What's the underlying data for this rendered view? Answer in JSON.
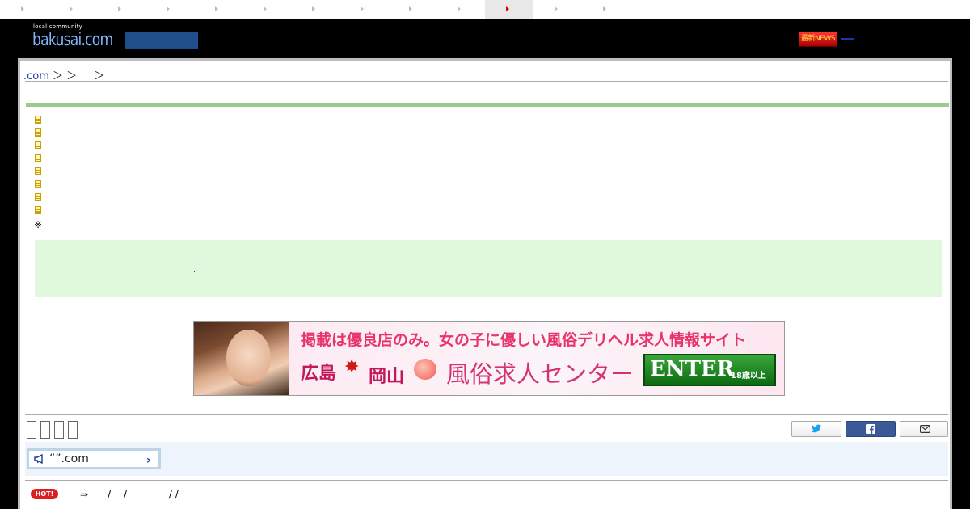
{
  "top_nav": {
    "active_index": 10,
    "item_count": 13
  },
  "header": {
    "logo_tagline": "local community",
    "logo_text": "bakusai.com",
    "news_label": "最新NEWS"
  },
  "breadcrumb": {
    "home": ".com",
    "separators": " ＞ ＞ 　 ＞"
  },
  "doc_list": {
    "count": 8
  },
  "note_mark": "※",
  "banner": {
    "headline": "掲載は優良店のみ。女の子に優しい風俗デリヘル求人情報サイト",
    "region1": "広島",
    "region2": "岡山",
    "site_name": "風俗求人センター",
    "enter_label": "ENTER",
    "age_label": "18歳以上"
  },
  "announce": {
    "text": "“”.com"
  },
  "hot": {
    "badge": "HOT!",
    "text": "⇒　　/　 /　　　　 / /"
  },
  "colors": {
    "logo": "#7eb6ff",
    "green_bar": "#9ccc8c",
    "info_box": "#e0f8dc",
    "facebook": "#3b5998",
    "twitter": "#1da1f2"
  },
  "icons": {
    "twitter": "twitter-icon",
    "facebook": "facebook-icon",
    "mail": "mail-icon",
    "megaphone": "megaphone-icon",
    "doc": "document-icon"
  }
}
